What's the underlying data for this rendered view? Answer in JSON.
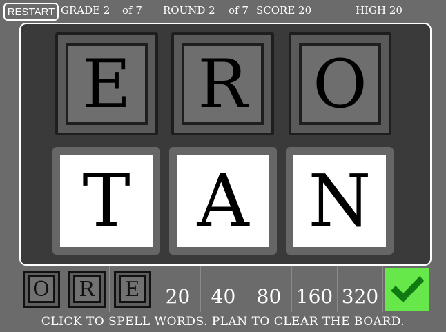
{
  "hud": {
    "restart_label": "RESTART",
    "grade_label": "GRADE 2",
    "grade_total": "of 7",
    "round_label": "ROUND 2",
    "round_total": "of 7",
    "score_label": "SCORE 20",
    "high_label": "HIGH 20"
  },
  "board": {
    "dim_tiles": [
      "E",
      "R",
      "O"
    ],
    "bright_tiles": [
      "T",
      "A",
      "N"
    ]
  },
  "tray": {
    "letters": [
      "O",
      "R",
      "E"
    ],
    "score_values": [
      "20",
      "40",
      "80",
      "160",
      "320"
    ],
    "submit_icon": "checkmark-icon"
  },
  "footer": {
    "instructions": "CLICK TO SPELL WORDS. PLAN TO CLEAR THE BOARD."
  },
  "colors": {
    "background": "#6b6b6b",
    "board": "#3a3a3a",
    "submit": "#66e84a",
    "checkmark": "#0f7a12"
  }
}
